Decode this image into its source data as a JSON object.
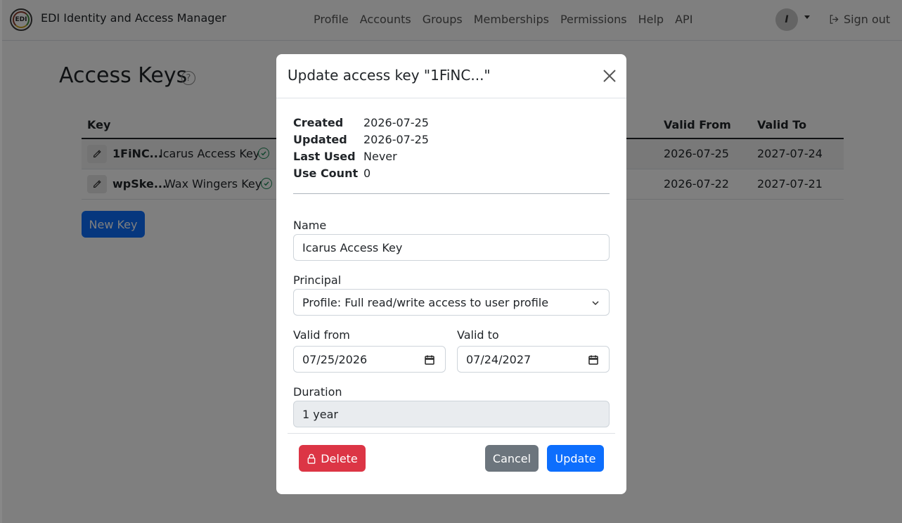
{
  "app": {
    "brand": "EDI Identity and Access Manager",
    "logo_text": "EDI"
  },
  "nav": {
    "links": [
      "Profile",
      "Accounts",
      "Groups",
      "Memberships",
      "Permissions",
      "Help",
      "API"
    ],
    "avatar_initial": "I",
    "signout": "Sign out"
  },
  "page": {
    "title": "Access Keys",
    "help_glyph": "?",
    "table": {
      "headers": {
        "key": "Key",
        "valid_from": "Valid From",
        "valid_to": "Valid To"
      },
      "rows": [
        {
          "key": "1FiNC...",
          "name": "Icarus Access Key",
          "valid_from": "2026-07-25",
          "valid_to": "2027-07-24"
        },
        {
          "key": "wpSke...",
          "name": "Wax Wingers Key",
          "valid_from": "2026-07-22",
          "valid_to": "2027-07-21"
        }
      ]
    },
    "new_key_button": "New Key"
  },
  "modal": {
    "title": "Update access key \"1FiNC...\"",
    "meta": [
      {
        "label": "Created",
        "value": "2026-07-25"
      },
      {
        "label": "Updated",
        "value": "2026-07-25"
      },
      {
        "label": "Last Used",
        "value": "Never"
      },
      {
        "label": "Use Count",
        "value": "0"
      }
    ],
    "name": {
      "label": "Name",
      "value": "Icarus Access Key"
    },
    "principal": {
      "label": "Principal",
      "value": "Profile: Full read/write access to user profile"
    },
    "valid_from": {
      "label": "Valid from",
      "value": "07/25/2026"
    },
    "valid_to": {
      "label": "Valid to",
      "value": "07/24/2027"
    },
    "duration": {
      "label": "Duration",
      "value": "1 year"
    },
    "buttons": {
      "delete": "Delete",
      "cancel": "Cancel",
      "update": "Update"
    }
  },
  "colors": {
    "primary": "#0d6efd",
    "danger": "#dc3545",
    "secondary": "#6c757d",
    "success": "#198754",
    "backdrop": "rgba(0,0,0,0.5)"
  },
  "icons": [
    "help-icon",
    "pencil-icon",
    "check-circle-icon",
    "sign-out-icon",
    "close-icon",
    "chevron-down-icon",
    "calendar-icon",
    "lock-icon"
  ]
}
